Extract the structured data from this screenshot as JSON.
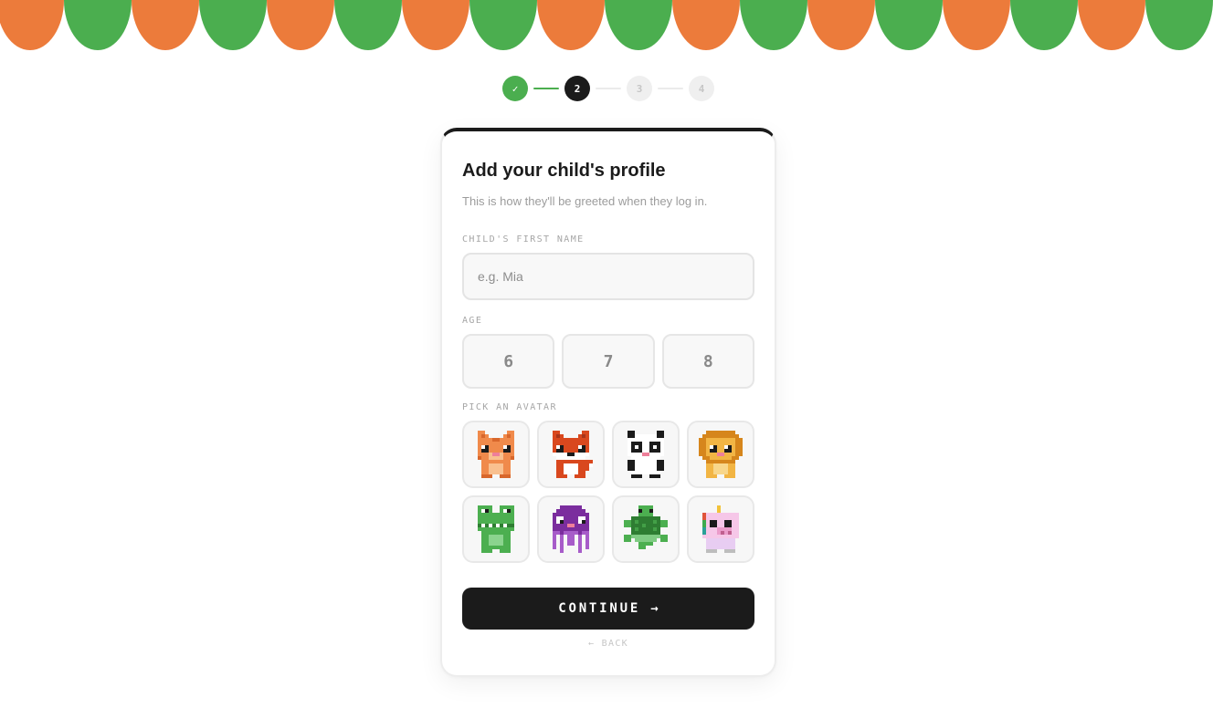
{
  "theme": {
    "orange": "#EC7B3B",
    "green": "#4BAE4F",
    "dark": "#1B1B1B"
  },
  "stepper": {
    "steps": [
      "✓",
      "2",
      "3",
      "4"
    ],
    "current_step": 2
  },
  "card": {
    "title": "Add your child's profile",
    "subtitle": "This is how they'll be greeted when they log in."
  },
  "name_field": {
    "label": "CHILD'S FIRST NAME",
    "value": "",
    "placeholder": "e.g. Mia"
  },
  "age": {
    "label": "AGE",
    "options": [
      "6",
      "7",
      "8"
    ]
  },
  "avatar_picker": {
    "label": "PICK AN AVATAR",
    "options": [
      "cat-avatar-icon",
      "fox-avatar-icon",
      "panda-avatar-icon",
      "lion-avatar-icon",
      "crocodile-avatar-icon",
      "octopus-avatar-icon",
      "turtle-avatar-icon",
      "unicorn-avatar-icon"
    ]
  },
  "actions": {
    "continue_label": "CONTINUE →",
    "back_label": "← BACK"
  }
}
